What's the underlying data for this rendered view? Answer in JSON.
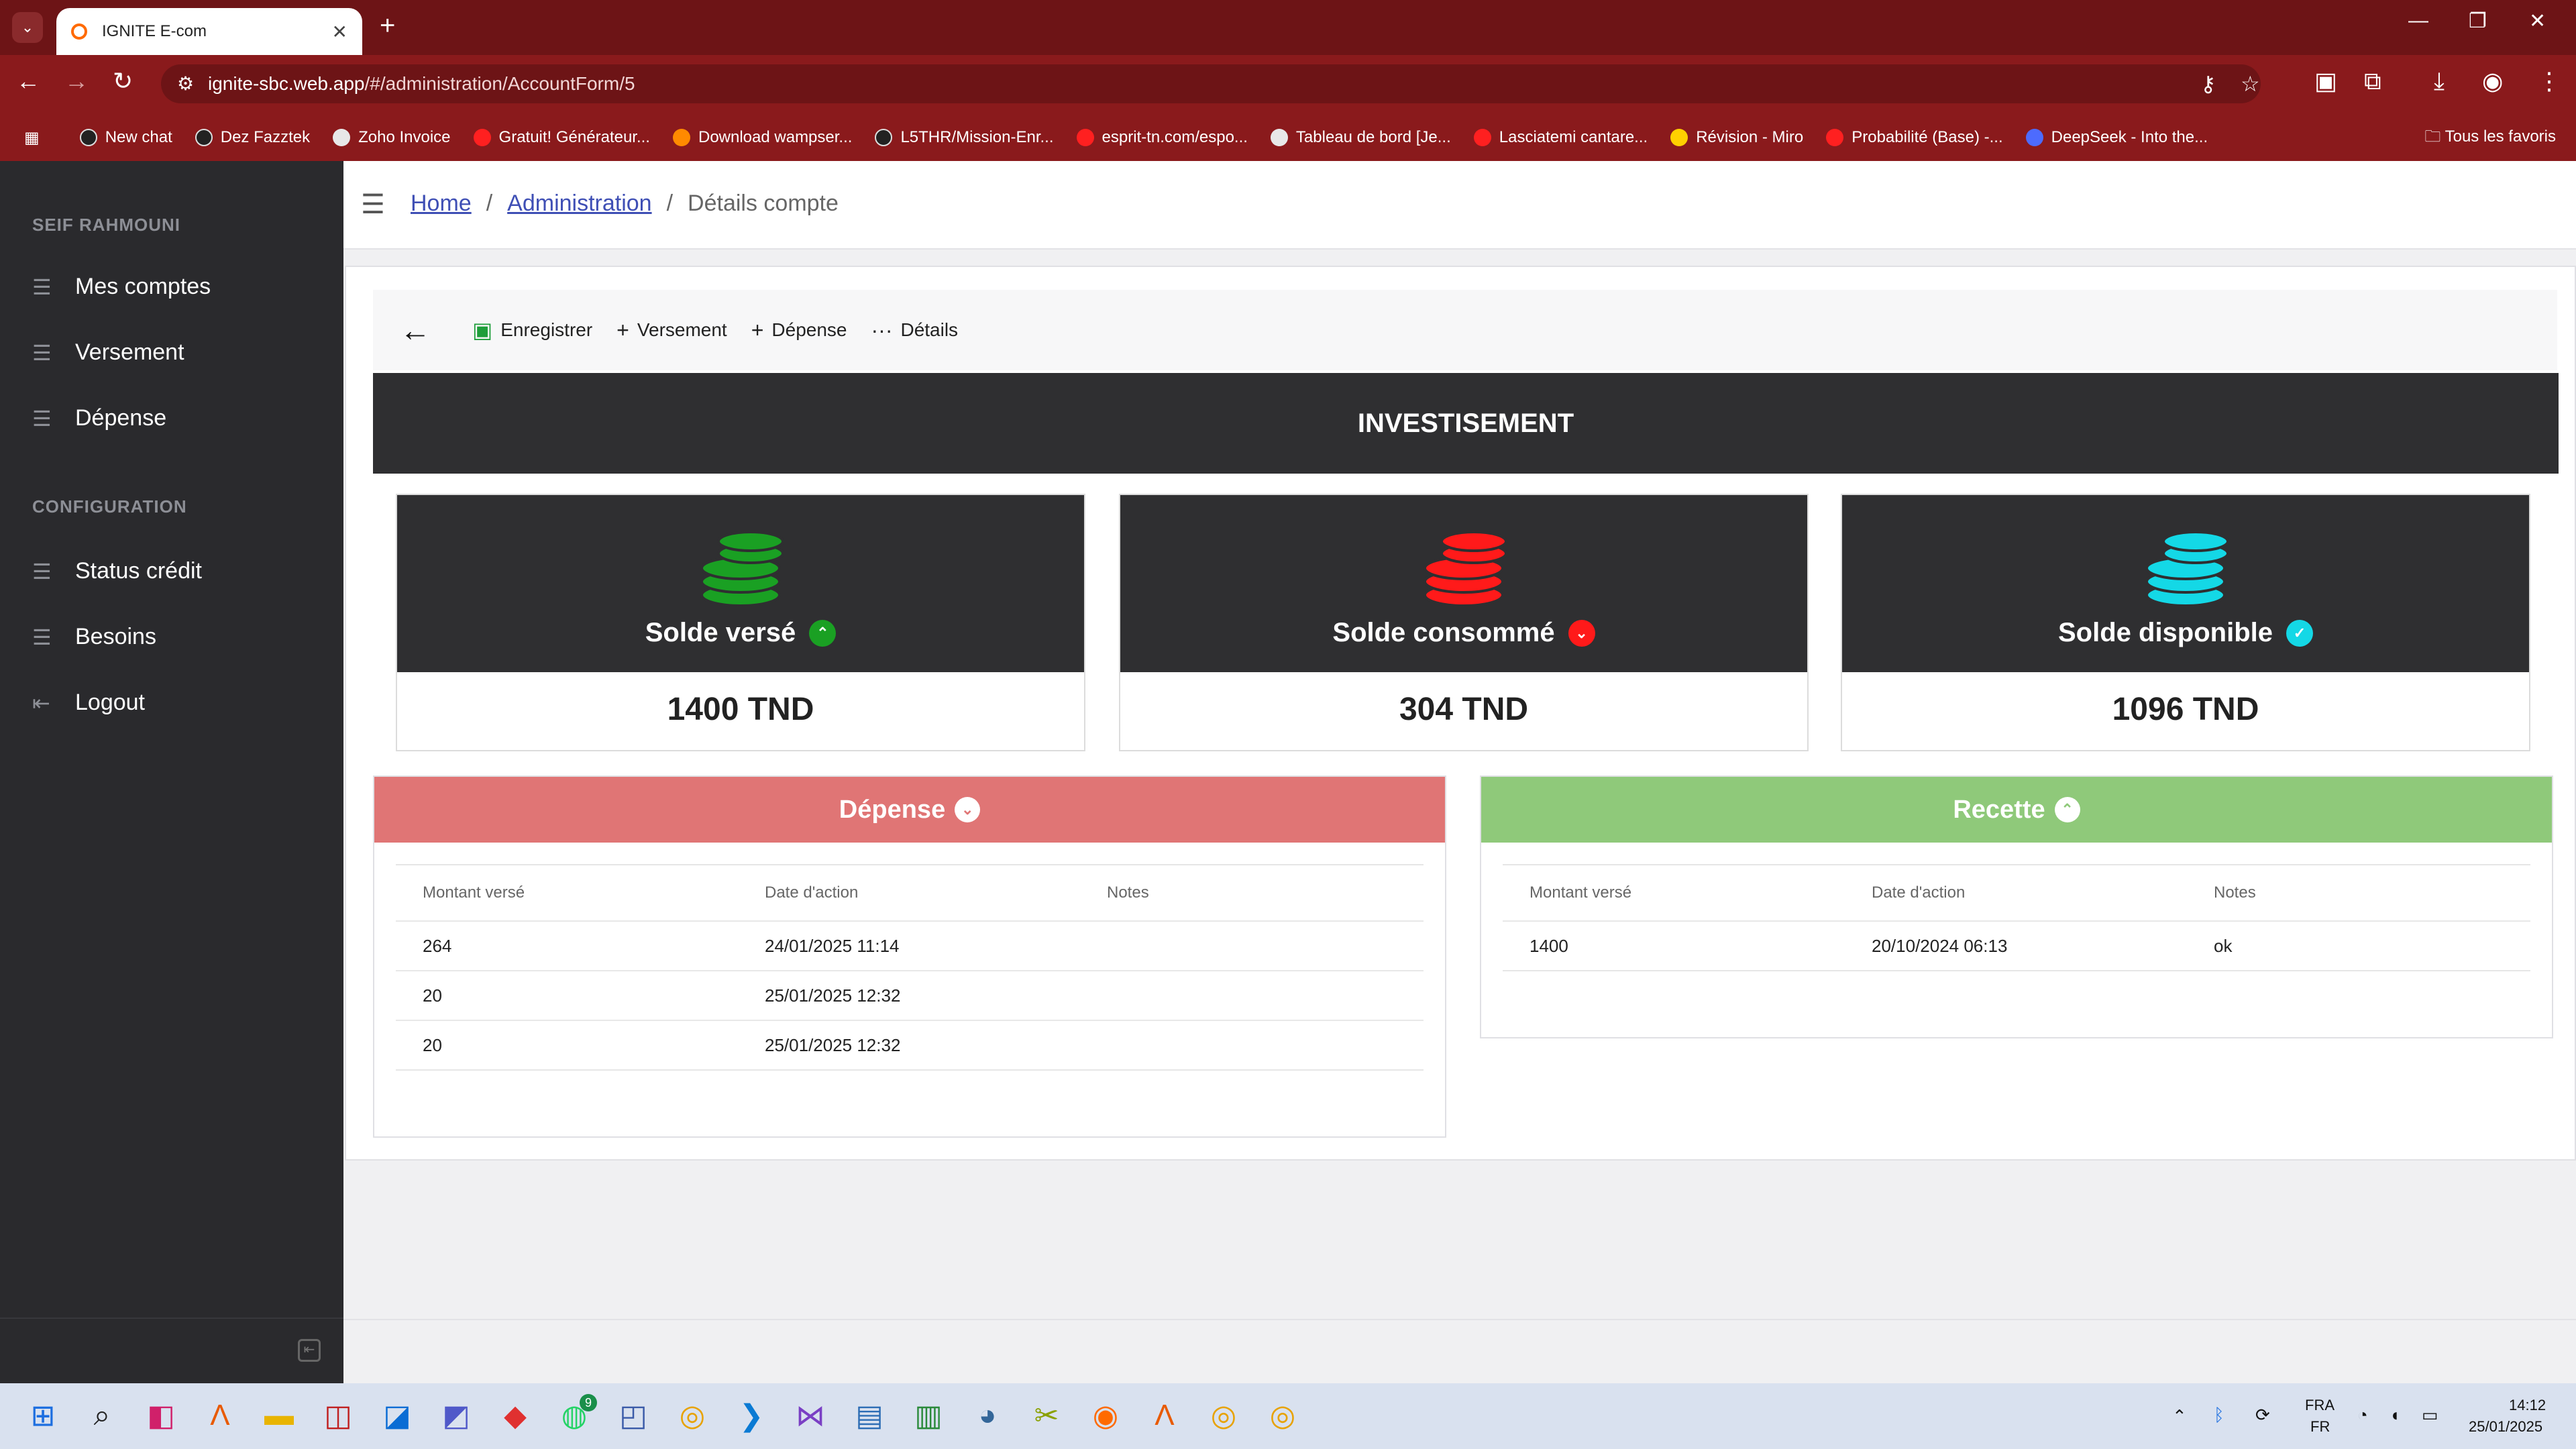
{
  "browser": {
    "tab_title": "IGNITE E-com",
    "url_host": "ignite-sbc.web.app",
    "url_path": "/#/administration/AccountForm/5",
    "bookmarks": [
      "New chat",
      "Dez Fazztek",
      "Zoho Invoice",
      "Gratuit! Générateur...",
      "Download wampser...",
      "L5THR/Mission-Enr...",
      "esprit-tn.com/espo...",
      "Tableau de bord [Je...",
      "Lasciatemi cantare...",
      "Révision - Miro",
      "Probabilité (Base) -...",
      "DeepSeek - Into the..."
    ],
    "all_favorites": "Tous les favoris"
  },
  "sidebar": {
    "user": "SEIF RAHMOUNI",
    "items": [
      "Mes comptes",
      "Versement",
      "Dépense"
    ],
    "config_title": "CONFIGURATION",
    "config_items": [
      "Status crédit",
      "Besoins",
      "Logout"
    ]
  },
  "breadcrumb": {
    "home": "Home",
    "admin": "Administration",
    "current": "Détails compte"
  },
  "toolbar": {
    "save": "Enregistrer",
    "versement": "Versement",
    "depense": "Dépense",
    "details": "Détails"
  },
  "account": {
    "title": "INVESTISEMENT"
  },
  "stats": [
    {
      "label": "Solde versé",
      "value": "1400 TND",
      "color": "#1aa023"
    },
    {
      "label": "Solde consommé",
      "value": "304 TND",
      "color": "#ff1a1a"
    },
    {
      "label": "Solde disponible",
      "value": "1096 TND",
      "color": "#14d8e6"
    }
  ],
  "depense": {
    "title": "Dépense",
    "color": "#e07575",
    "headers": [
      "Montant versé",
      "Date d'action",
      "Notes"
    ],
    "rows": [
      [
        "264",
        "24/01/2025 11:14",
        ""
      ],
      [
        "20",
        "25/01/2025 12:32",
        ""
      ],
      [
        "20",
        "25/01/2025 12:32",
        ""
      ]
    ]
  },
  "recette": {
    "title": "Recette",
    "color": "#8fc97a",
    "headers": [
      "Montant versé",
      "Date d'action",
      "Notes"
    ],
    "rows": [
      [
        "1400",
        "20/10/2024 06:13",
        "ok"
      ]
    ]
  },
  "taskbar": {
    "lang1": "FRA",
    "lang2": "FR",
    "time": "14:12",
    "date": "25/01/2025",
    "whatsapp_badge": "9"
  }
}
